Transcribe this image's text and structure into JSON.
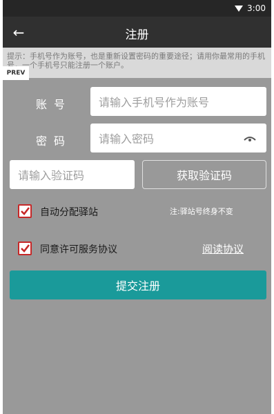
{
  "status_bar": {
    "time": "3:00",
    "wifi_icon": "wifi-icon"
  },
  "app_bar": {
    "back_glyph": "←",
    "title": "注册"
  },
  "hint": {
    "text": "提示：手机号作为账号，也是重新设置密码的重要途径；请用你最常用的手机号，一个手机号只能注册一个账户。"
  },
  "prev_tag": "PREV",
  "account": {
    "label": "账号",
    "placeholder": "请输入手机号作为账号"
  },
  "password": {
    "label": "密码",
    "placeholder": "请输入密码",
    "toggle_icon": "eye-icon"
  },
  "verify": {
    "placeholder": "请输入验证码",
    "button_label": "获取验证码"
  },
  "auto_station": {
    "label": "自动分配驿站",
    "checked": true,
    "note": "注:驿站号终身不变"
  },
  "agreement": {
    "label": "同意许可服务协议",
    "checked": true,
    "link": "阅读协议"
  },
  "submit": {
    "label": "提交注册",
    "color": "#1a9a9a"
  },
  "colors": {
    "background": "#999999",
    "app_bar": "#303030",
    "status_bar": "#262626",
    "checkbox_accent": "#c62828"
  }
}
